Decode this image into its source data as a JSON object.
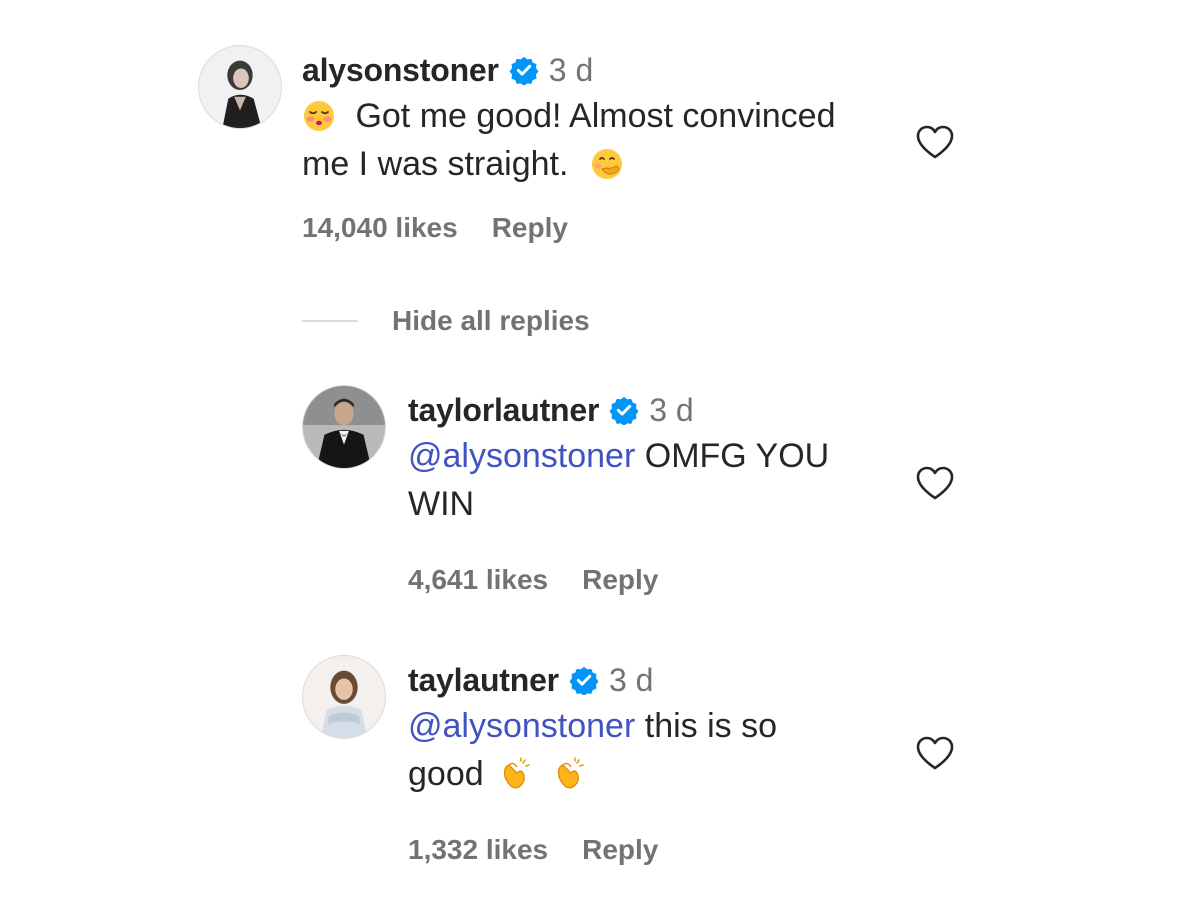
{
  "comments": [
    {
      "username": "alysonstoner",
      "verified_icon": "verified-badge-icon",
      "time": "3 d",
      "text_line1": "Got me good! Almost convinced",
      "text_line2": "me I was straight.",
      "leading_emoji": "kissing-face-emoji",
      "trailing_emoji": "face-with-hand-over-mouth-emoji",
      "likes": "14,040 likes",
      "reply_label": "Reply",
      "like_icon": "heart-outline-icon"
    }
  ],
  "thread": {
    "hide_replies_label": "Hide all replies"
  },
  "replies": [
    {
      "username": "taylorlautner",
      "verified_icon": "verified-badge-icon",
      "time": "3 d",
      "mention": "@alysonstoner",
      "text_line1": " OMFG YOU",
      "text_line2": "WIN",
      "likes": "4,641 likes",
      "reply_label": "Reply",
      "like_icon": "heart-outline-icon"
    },
    {
      "username": "taylautner",
      "verified_icon": "verified-badge-icon",
      "time": "3 d",
      "mention": "@alysonstoner",
      "text_line1": " this is so",
      "text_line2": "good",
      "trailing_emoji": "clapping-hands-emoji",
      "likes": "1,332 likes",
      "reply_label": "Reply",
      "like_icon": "heart-outline-icon"
    }
  ],
  "colors": {
    "text": "#262626",
    "secondary": "#737373",
    "mention": "#4153c2",
    "verified": "#0095f6",
    "divider": "#dbdbdb"
  }
}
